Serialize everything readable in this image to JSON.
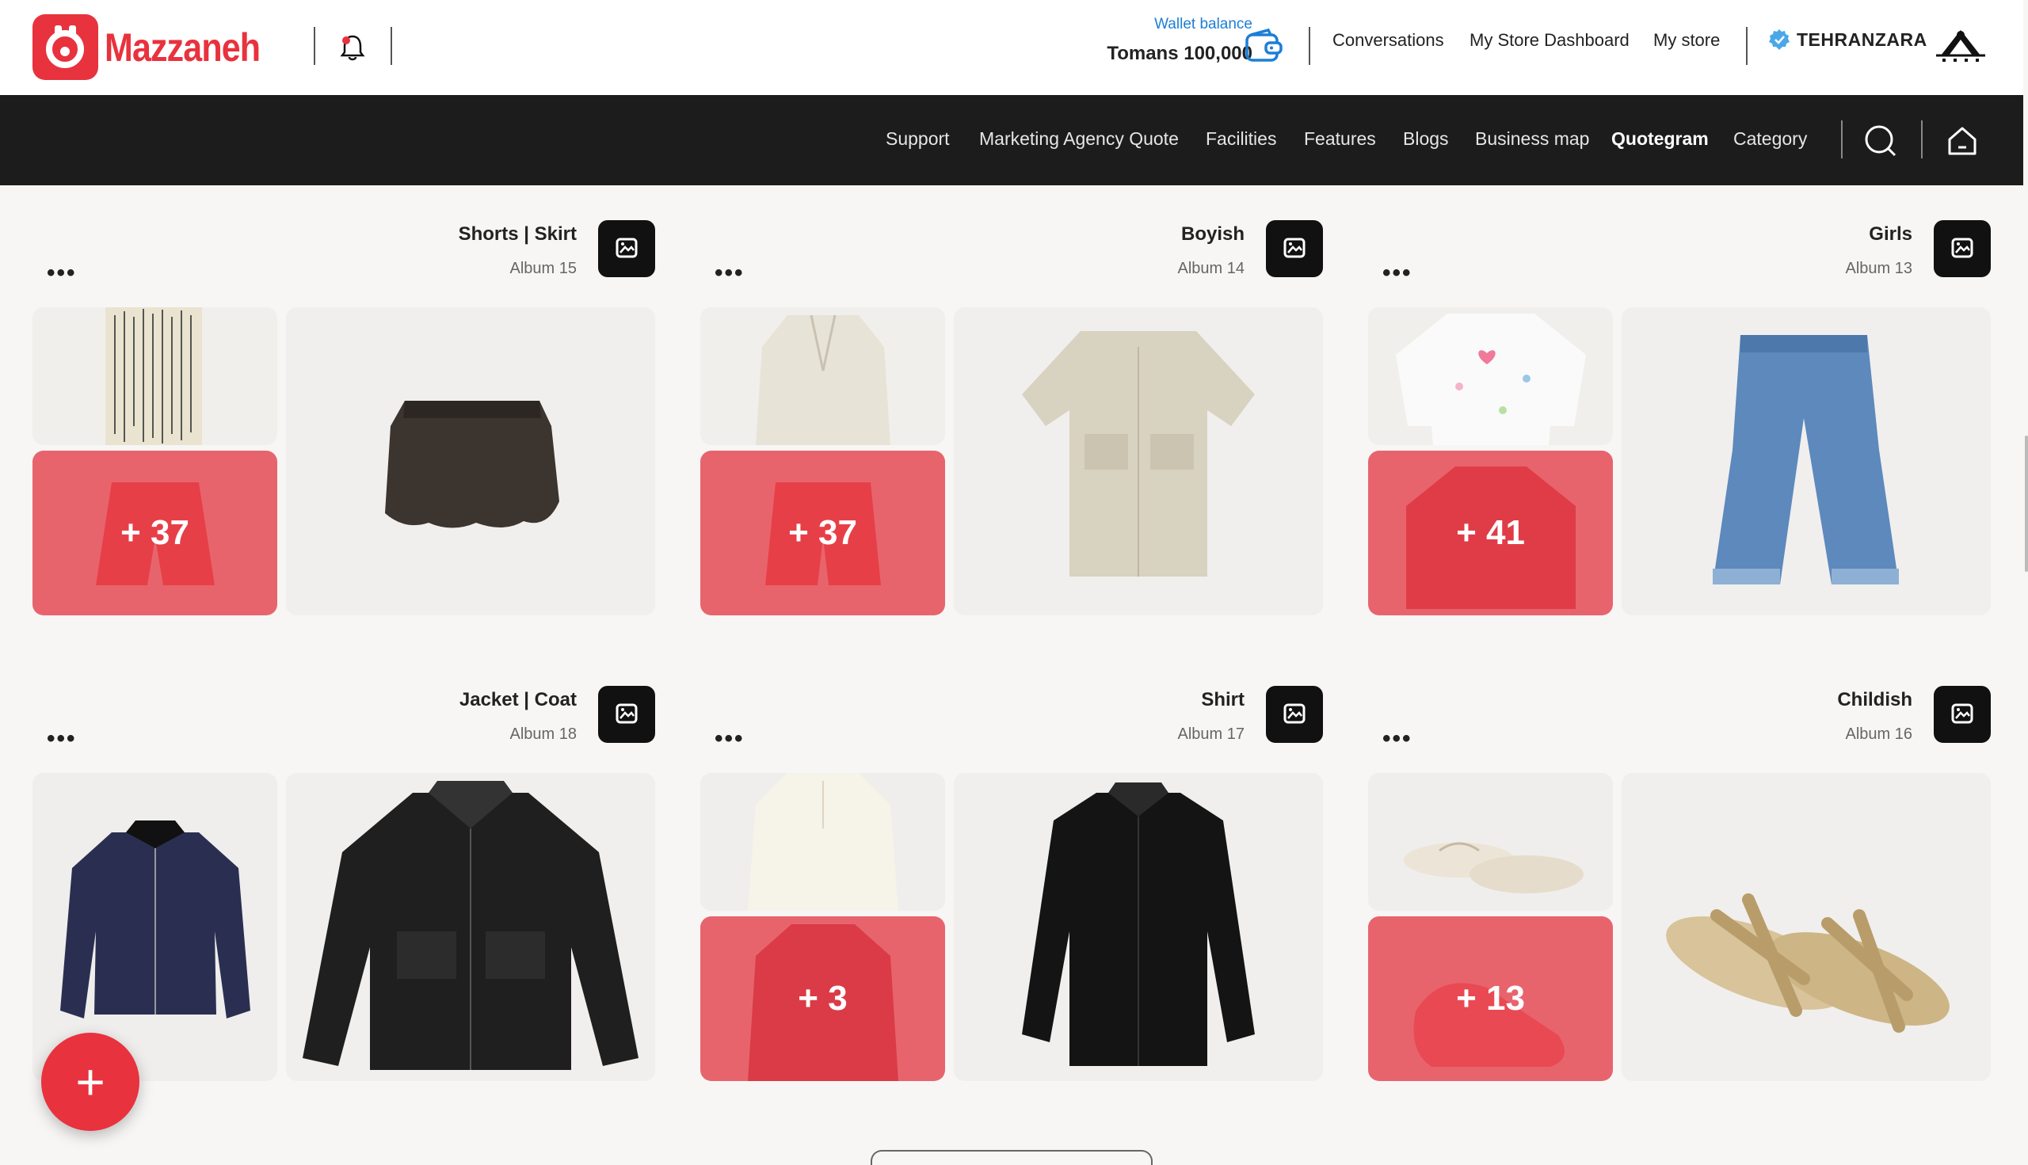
{
  "brand": {
    "name": "Mazzaneh",
    "color": "#e8323d"
  },
  "wallet": {
    "label": "Wallet balance",
    "currency": "Tomans",
    "amount": "100,000"
  },
  "top_links": [
    "Conversations",
    "My Store Dashboard",
    "My store"
  ],
  "user": {
    "name": "TEHRANZARA"
  },
  "main_nav": [
    "Support",
    "Marketing Agency Quote",
    "Facilities",
    "Features",
    "Blogs",
    "Business map",
    "Quotegram",
    "Category"
  ],
  "active_nav": "Quotegram",
  "albums": [
    {
      "title": "Shorts | Skirt",
      "count": "Album 15",
      "more": "+ 37"
    },
    {
      "title": "Boyish",
      "count": "Album 14",
      "more": "+ 37"
    },
    {
      "title": "Girls",
      "count": "Album 13",
      "more": "+ 41"
    },
    {
      "title": "Jacket | Coat",
      "count": "Album 18",
      "more": ""
    },
    {
      "title": "Shirt",
      "count": "Album 17",
      "more": "+ 3"
    },
    {
      "title": "Childish",
      "count": "Album 16",
      "more": "+ 13"
    }
  ],
  "fab": {
    "label": "+"
  }
}
